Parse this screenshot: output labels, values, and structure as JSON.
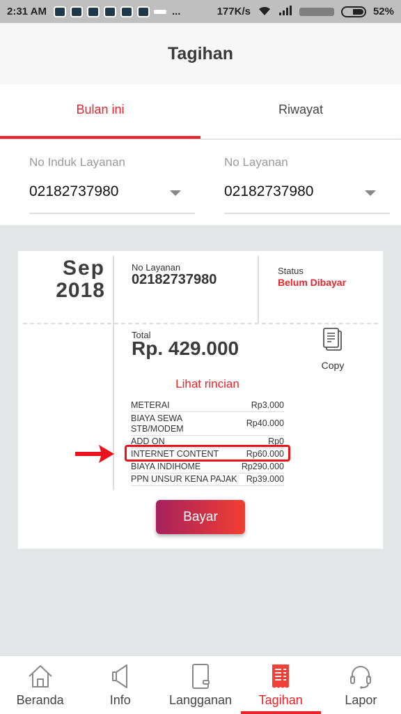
{
  "status_bar": {
    "time": "2:31 AM",
    "dots": "...",
    "speed": "177K/s",
    "battery": "52%",
    "battery_level": 0.52
  },
  "header": {
    "title": "Tagihan"
  },
  "tabs": [
    {
      "label": "Bulan ini",
      "active": true
    },
    {
      "label": "Riwayat",
      "active": false
    }
  ],
  "selectors": {
    "no_induk": {
      "label": "No Induk Layanan",
      "value": "02182737980"
    },
    "no_layanan": {
      "label": "No Layanan",
      "value": "02182737980"
    }
  },
  "bill": {
    "month": "Sep",
    "year": "2018",
    "no_layanan_label": "No Layanan",
    "no_layanan_value": "02182737980",
    "status_label": "Status",
    "status_value": "Belum Dibayar",
    "total_label": "Total",
    "total_value": "Rp. 429.000",
    "copy_label": "Copy",
    "detail_link": "Lihat rincian",
    "details": [
      {
        "label": "METERAI",
        "value": "Rp3.000"
      },
      {
        "label": "BIAYA SEWA STB/MODEM",
        "value": "Rp40.000"
      },
      {
        "label": "ADD ON",
        "value": "Rp0"
      },
      {
        "label": "INTERNET CONTENT",
        "value": "Rp60.000",
        "highlighted": true
      },
      {
        "label": "BIAYA INDIHOME",
        "value": "Rp290.000"
      },
      {
        "label": "PPN UNSUR KENA PAJAK",
        "value": "Rp39.000"
      }
    ],
    "pay_button": "Bayar"
  },
  "bottom_nav": [
    {
      "label": "Beranda",
      "icon": "home-icon"
    },
    {
      "label": "Info",
      "icon": "megaphone-icon"
    },
    {
      "label": "Langganan",
      "icon": "notebook-icon"
    },
    {
      "label": "Tagihan",
      "icon": "receipt-icon",
      "active": true
    },
    {
      "label": "Lapor",
      "icon": "headset-icon"
    }
  ],
  "colors": {
    "accent": "#e8232a",
    "gradient_start": "#a6215d",
    "gradient_end": "#f23e32",
    "background": "#e4e5e7"
  }
}
